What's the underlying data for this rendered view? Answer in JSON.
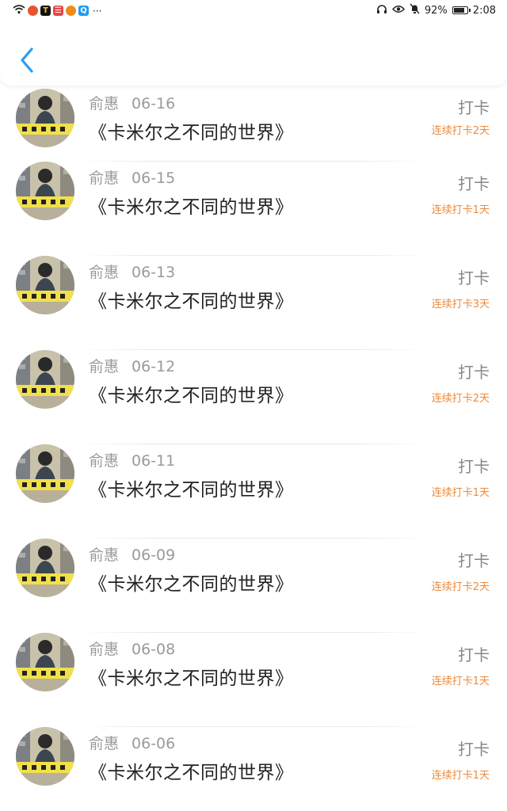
{
  "status_bar": {
    "battery": "92%",
    "time": "2:08",
    "more": "···"
  },
  "colors": {
    "accent_blue": "#2a9df4",
    "streak_orange": "#ee8a3a",
    "meta_gray": "#9a9a9a"
  },
  "header": {
    "back_icon": "chevron-left-icon"
  },
  "entries": [
    {
      "name": "俞惠",
      "date": "06-16",
      "title": "《卡米尔之不同的世界》",
      "action": "打卡",
      "streak": "连续打卡2天"
    },
    {
      "name": "俞惠",
      "date": "06-15",
      "title": "《卡米尔之不同的世界》",
      "action": "打卡",
      "streak": "连续打卡1天"
    },
    {
      "name": "俞惠",
      "date": "06-13",
      "title": "《卡米尔之不同的世界》",
      "action": "打卡",
      "streak": "连续打卡3天"
    },
    {
      "name": "俞惠",
      "date": "06-12",
      "title": "《卡米尔之不同的世界》",
      "action": "打卡",
      "streak": "连续打卡2天"
    },
    {
      "name": "俞惠",
      "date": "06-11",
      "title": "《卡米尔之不同的世界》",
      "action": "打卡",
      "streak": "连续打卡1天"
    },
    {
      "name": "俞惠",
      "date": "06-09",
      "title": "《卡米尔之不同的世界》",
      "action": "打卡",
      "streak": "连续打卡2天"
    },
    {
      "name": "俞惠",
      "date": "06-08",
      "title": "《卡米尔之不同的世界》",
      "action": "打卡",
      "streak": "连续打卡1天"
    },
    {
      "name": "俞惠",
      "date": "06-06",
      "title": "《卡米尔之不同的世界》",
      "action": "打卡",
      "streak": "连续打卡1天"
    }
  ]
}
